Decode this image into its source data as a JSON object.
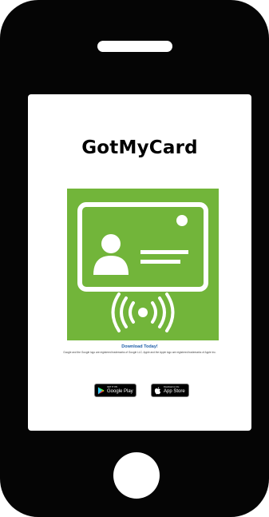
{
  "app": {
    "title": "GotMyCard"
  },
  "logo": {
    "name": "id-card-contactless-icon",
    "background_color": "#72b53a",
    "foreground_color": "#ffffff"
  },
  "download": {
    "title": "Download Today!",
    "trademark": "Google and the Google logo are registered trademarks of Google LLC. Apple and the Apple logo are registered trademarks of Apple Inc."
  },
  "stores": {
    "google": {
      "small": "GET IT ON",
      "big": "Google Play",
      "icon": "google-play-icon"
    },
    "apple": {
      "small": "Download on the",
      "big": "App Store",
      "icon": "apple-icon"
    }
  },
  "colors": {
    "phone_body": "#050505",
    "link_blue": "#1f5fa8"
  }
}
